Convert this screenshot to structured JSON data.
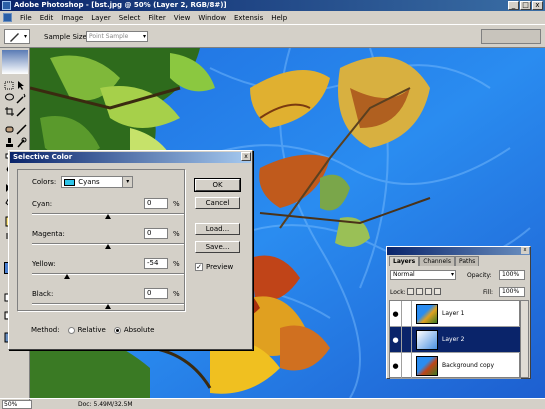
{
  "app": {
    "title": "Adobe Photoshop - [bst.jpg @ 50% (Layer 2, RGB/8#)]",
    "window_buttons": [
      "_",
      "□",
      "x"
    ]
  },
  "menubar": {
    "items": [
      "File",
      "Edit",
      "Image",
      "Layer",
      "Select",
      "Filter",
      "View",
      "Window",
      "Extensis",
      "Help"
    ]
  },
  "options_bar": {
    "sample_size_label": "Sample Size:",
    "sample_size_value": "Point Sample"
  },
  "dialog": {
    "title": "Selective Color",
    "close_label": "x",
    "colors_label": "Colors:",
    "colors_value": "Cyans",
    "colors_swatch": "#2ec4e8",
    "channels": [
      {
        "label": "Cyan:",
        "value": "0",
        "unit": "%",
        "level": 0
      },
      {
        "label": "Magenta:",
        "value": "0",
        "unit": "%",
        "level": 0
      },
      {
        "label": "Yellow:",
        "value": "-54",
        "unit": "%",
        "level": -54
      },
      {
        "label": "Black:",
        "value": "0",
        "unit": "%",
        "level": 0
      }
    ],
    "method_label": "Method:",
    "method_options": [
      "Relative",
      "Absolute"
    ],
    "method_selected": "Absolute",
    "buttons": {
      "ok": "OK",
      "cancel": "Cancel",
      "load": "Load...",
      "save": "Save..."
    },
    "preview_label": "Preview",
    "preview_checked": true
  },
  "layers_panel": {
    "tabs": [
      "Layers",
      "Channels",
      "Paths"
    ],
    "blend_mode": "Normal",
    "opacity_label": "Opacity:",
    "opacity_value": "100%",
    "lock_label": "Lock:",
    "fill_label": "Fill:",
    "fill_value": "100%",
    "layers": [
      {
        "name": "Layer 1",
        "selected": false
      },
      {
        "name": "Layer 2",
        "selected": true
      },
      {
        "name": "Background copy",
        "selected": false
      }
    ]
  },
  "status_bar": {
    "zoom": "50%",
    "doc": "Doc: 5.49M/32.5M"
  }
}
